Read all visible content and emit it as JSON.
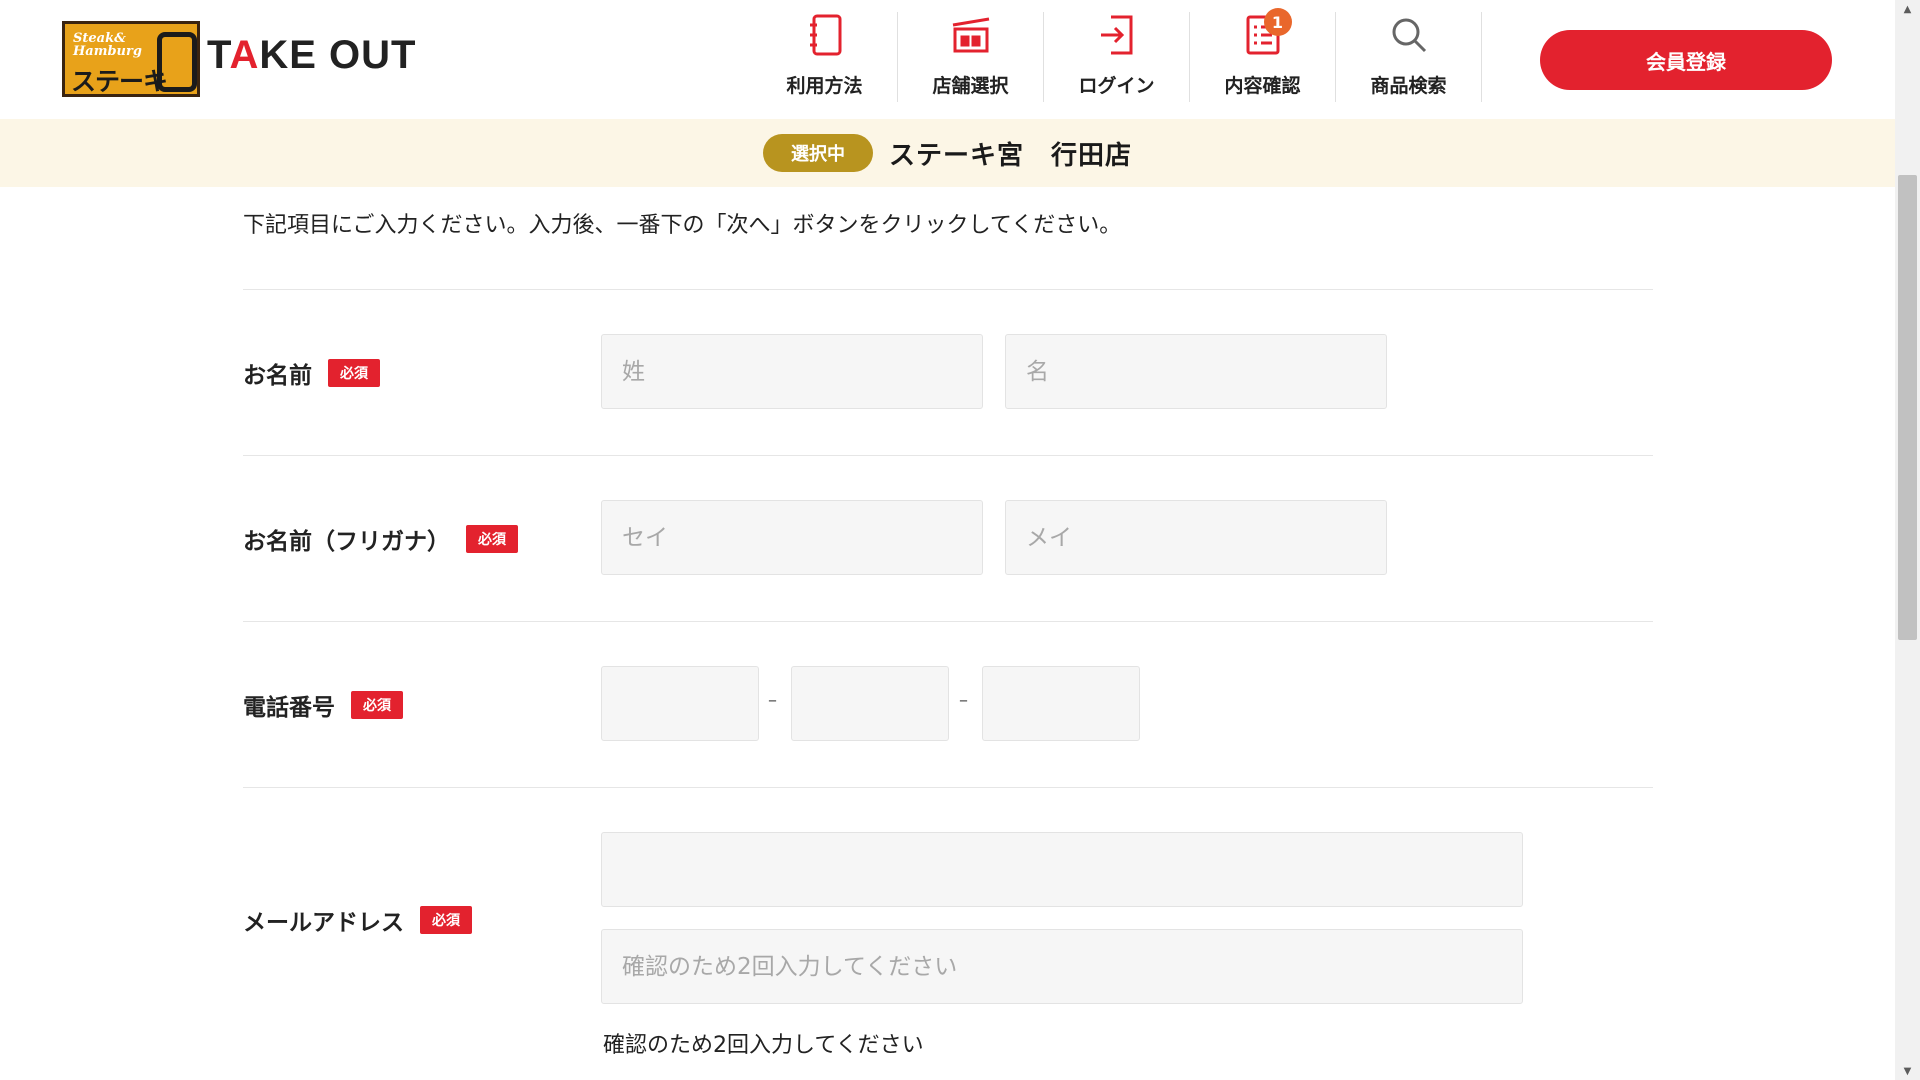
{
  "header": {
    "logo_small_line1": "Steak&",
    "logo_small_line2": "Hamburg",
    "logo_big": "ステーキ",
    "brand_prefix": "T",
    "brand_accent": "A",
    "brand_suffix": "KE OUT",
    "nav": [
      {
        "label": "利用方法",
        "icon": "guide-book-icon"
      },
      {
        "label": "店舗選択",
        "icon": "store-icon"
      },
      {
        "label": "ログイン",
        "icon": "login-icon"
      },
      {
        "label": "内容確認",
        "icon": "order-list-icon",
        "badge": "1"
      },
      {
        "label": "商品検索",
        "icon": "search-icon"
      }
    ],
    "register_label": "会員登録"
  },
  "store_bar": {
    "status": "選択中",
    "store_name": "ステーキ宮　行田店"
  },
  "form": {
    "intro": "下記項目にご入力ください。入力後、一番下の「次へ」ボタンをクリックしてください。",
    "required_label": "必須",
    "name": {
      "label": "お名前",
      "last_placeholder": "姓",
      "first_placeholder": "名"
    },
    "kana": {
      "label": "お名前（フリガナ）",
      "last_placeholder": "セイ",
      "first_placeholder": "メイ"
    },
    "phone": {
      "label": "電話番号",
      "separator": "–"
    },
    "email": {
      "label": "メールアドレス",
      "confirm_placeholder": "確認のため2回入力してください",
      "hint": "確認のため2回入力してください"
    }
  },
  "colors": {
    "accent_red": "#e3222e",
    "store_pill": "#b8941f",
    "store_bar_bg": "#fcf6e6",
    "badge": "#e9672c"
  }
}
